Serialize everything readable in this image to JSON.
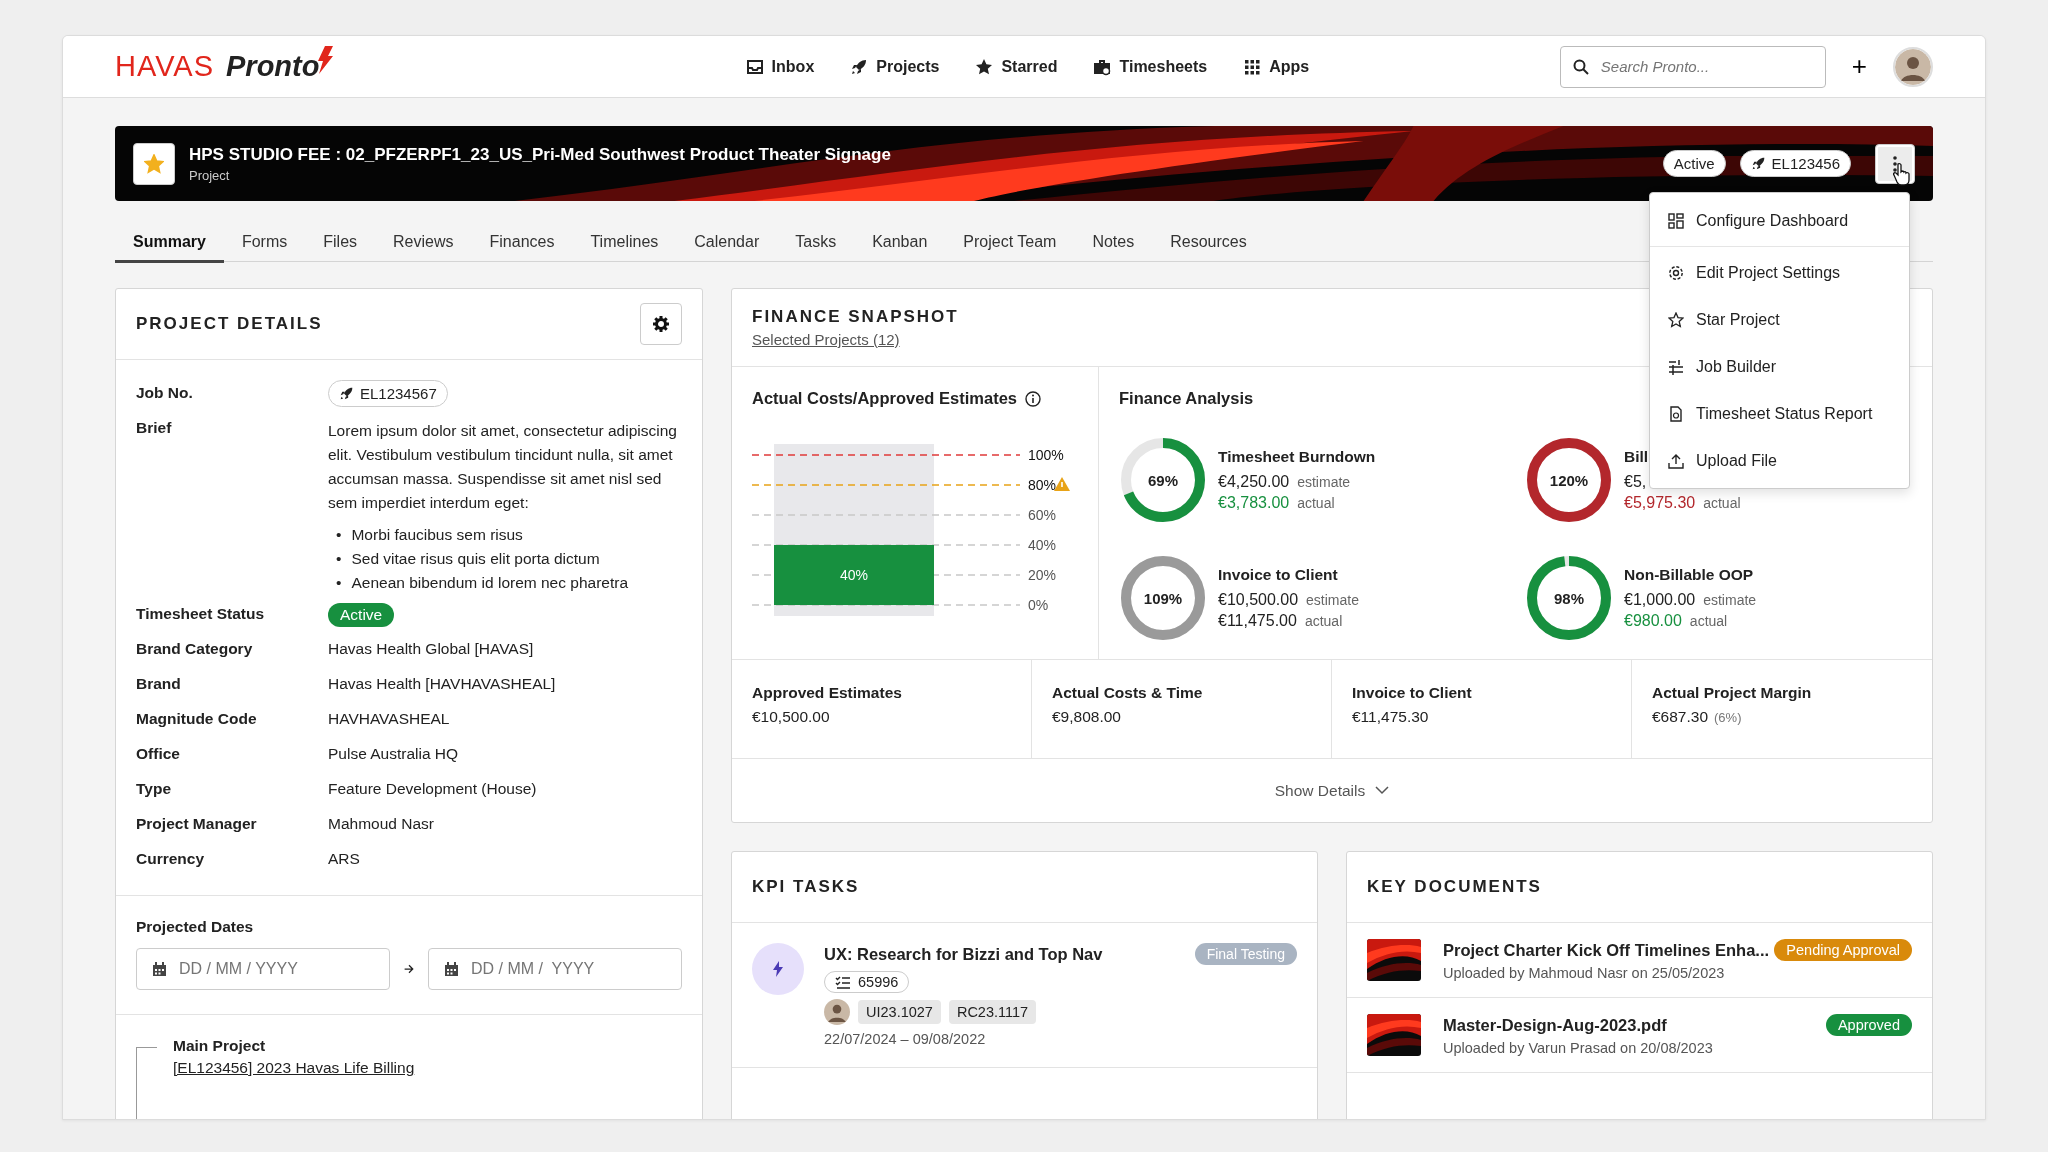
{
  "logo": {
    "brand": "HAVAS",
    "product": "Pronto"
  },
  "nav": [
    {
      "label": "Inbox"
    },
    {
      "label": "Projects"
    },
    {
      "label": "Starred"
    },
    {
      "label": "Timesheets"
    },
    {
      "label": "Apps"
    }
  ],
  "search": {
    "placeholder": "Search Pronto..."
  },
  "add_button": "+",
  "project": {
    "title": "HPS STUDIO FEE : 02_PFZERPF1_23_US_Pri-Med Southwest Product Theater Signage",
    "subtitle": "Project",
    "starred": true,
    "status": "Active",
    "job_no": "EL123456",
    "menu_open": true
  },
  "menu": [
    {
      "label": "Configure Dashboard"
    },
    {
      "label": "Edit Project Settings"
    },
    {
      "label": "Star Project"
    },
    {
      "label": "Job Builder"
    },
    {
      "label": "Timesheet Status Report"
    },
    {
      "label": "Upload File"
    }
  ],
  "tabs": [
    {
      "label": "Summary",
      "selected": true
    },
    {
      "label": "Forms",
      "selected": false
    },
    {
      "label": "Files",
      "selected": false
    },
    {
      "label": "Reviews",
      "selected": false
    },
    {
      "label": "Finances",
      "selected": false
    },
    {
      "label": "Timelines",
      "selected": false
    },
    {
      "label": "Calendar",
      "selected": false
    },
    {
      "label": "Tasks",
      "selected": false
    },
    {
      "label": "Kanban",
      "selected": false
    },
    {
      "label": "Project Team",
      "selected": false
    },
    {
      "label": "Notes",
      "selected": false
    },
    {
      "label": "Resources",
      "selected": false
    }
  ],
  "project_details": {
    "title": "PROJECT DETAILS",
    "rows": [
      {
        "label": "Job No.",
        "kind": "job",
        "value": "EL1234567"
      },
      {
        "label": "Brief",
        "kind": "brief",
        "value": "Lorem ipsum dolor sit amet, consectetur adipiscing elit. Vestibulum vestibulum tincidunt nulla, sit amet accumsan massa. Suspendisse sit amet nisl sed sem imperdiet interdum eget:",
        "marker": "•",
        "bullets": [
          "Morbi faucibus sem risus",
          "Sed vitae risus quis elit porta dictum",
          "Aenean bibendum id lorem nec pharetra"
        ]
      },
      {
        "label": "Timesheet Status",
        "kind": "status",
        "value": "Active"
      },
      {
        "label": "Brand Category",
        "kind": "text",
        "value": "Havas Health Global [HAVAS]"
      },
      {
        "label": "Brand",
        "kind": "text",
        "value": "Havas Health [HAVHAVASHEAL]"
      },
      {
        "label": "Magnitude Code",
        "kind": "text",
        "value": "HAVHAVASHEAL"
      },
      {
        "label": "Office",
        "kind": "text",
        "value": "Pulse Australia HQ"
      },
      {
        "label": "Type",
        "kind": "text",
        "value": "Feature Development (House)"
      },
      {
        "label": "Project Manager",
        "kind": "text",
        "value": "Mahmoud Nasr"
      },
      {
        "label": "Currency",
        "kind": "text",
        "value": "ARS"
      }
    ],
    "projected_dates": {
      "label": "Projected Dates",
      "start": {
        "placeholder": "DD / MM / YYYY"
      },
      "end": {
        "placeholder": "DD / MM /  YYYY"
      }
    },
    "main_project": {
      "label": "Main Project",
      "link": "[EL123456] 2023 Havas Life Billing"
    }
  },
  "finance_snapshot": {
    "title": "FINANCE SNAPSHOT",
    "link": "Selected Projects (12)",
    "chart": {
      "title": "Actual Costs/Approved Estimates",
      "chart_data": {
        "type": "bar",
        "values": [
          40
        ],
        "ylim": [
          0,
          100
        ],
        "yticks": [
          {
            "value": 0,
            "label": "0%"
          },
          {
            "value": 20,
            "label": "20%"
          },
          {
            "value": 40,
            "label": "40%"
          },
          {
            "value": 60,
            "label": "60%"
          },
          {
            "value": 80,
            "label": "80%"
          },
          {
            "value": 100,
            "label": "100%"
          }
        ],
        "value_labels": [
          "40%"
        ],
        "grid": true,
        "ref_lines": [
          {
            "axis": "y",
            "value": 100,
            "color": "#e03a3a"
          },
          {
            "axis": "y",
            "value": 80,
            "color": "#e8a317"
          }
        ]
      },
      "warning": true
    },
    "analysis": {
      "title": "Finance Analysis",
      "items": [
        {
          "percent": "69%",
          "level": 0.69,
          "color": "#17903f",
          "actual_highlighted": true,
          "title": "Timesheet Burndown",
          "estimate": "€4,250.00",
          "estimate_label": "estimate",
          "actual": "€3,783.00",
          "actual_label": "actual"
        },
        {
          "percent": "120%",
          "level": 1,
          "color": "#b3272c",
          "actual_highlighted": true,
          "title": "Bill",
          "estimate": "€5,",
          "actual": "€5,975.30",
          "actual_label": "actual"
        },
        {
          "percent": "109%",
          "level": 1,
          "color": "#9a9a9a",
          "actual_highlighted": false,
          "title": "Invoice to Client",
          "estimate": "€10,500.00",
          "estimate_label": "estimate",
          "actual": "€11,475.00",
          "actual_label": "actual"
        },
        {
          "percent": "98%",
          "level": 0.98,
          "color": "#17903f",
          "actual_highlighted": true,
          "title": "Non-Billable OOP",
          "estimate": "€1,000.00",
          "estimate_label": "estimate",
          "actual": "€980.00",
          "actual_label": "actual"
        }
      ]
    },
    "totals": [
      {
        "label": "Approved Estimates",
        "value": "€10,500.00"
      },
      {
        "label": "Actual Costs & Time",
        "value": "€9,808.00"
      },
      {
        "label": "Invoice to Client",
        "value": "€11,475.30"
      },
      {
        "label": "Actual Project Margin",
        "value": "€687.30",
        "note": "(6%)"
      }
    ],
    "show_details": "Show Details"
  },
  "kpi_tasks": {
    "title": "KPI TASKS",
    "tasks": [
      {
        "title": "UX: Research for Bizzi and Top Nav",
        "status": "Final Testing",
        "count": "65996",
        "tags": [
          "UI23.1027",
          "RC23.1117"
        ],
        "dates": "22/07/2024 – 09/08/2022"
      }
    ]
  },
  "key_documents": {
    "title": "KEY DOCUMENTS",
    "documents": [
      {
        "title": "Project Charter Kick Off Timelines Enha...",
        "status": "Pending Approval",
        "color": "#d98a0b",
        "uploaded": "Uploaded by Mahmoud Nasr on 25/05/2023"
      },
      {
        "title": "Master-Design-Aug-2023.pdf",
        "status": "Approved",
        "color": "#17903f",
        "uploaded": "Uploaded by Varun Prasad on 20/08/2023"
      }
    ]
  }
}
